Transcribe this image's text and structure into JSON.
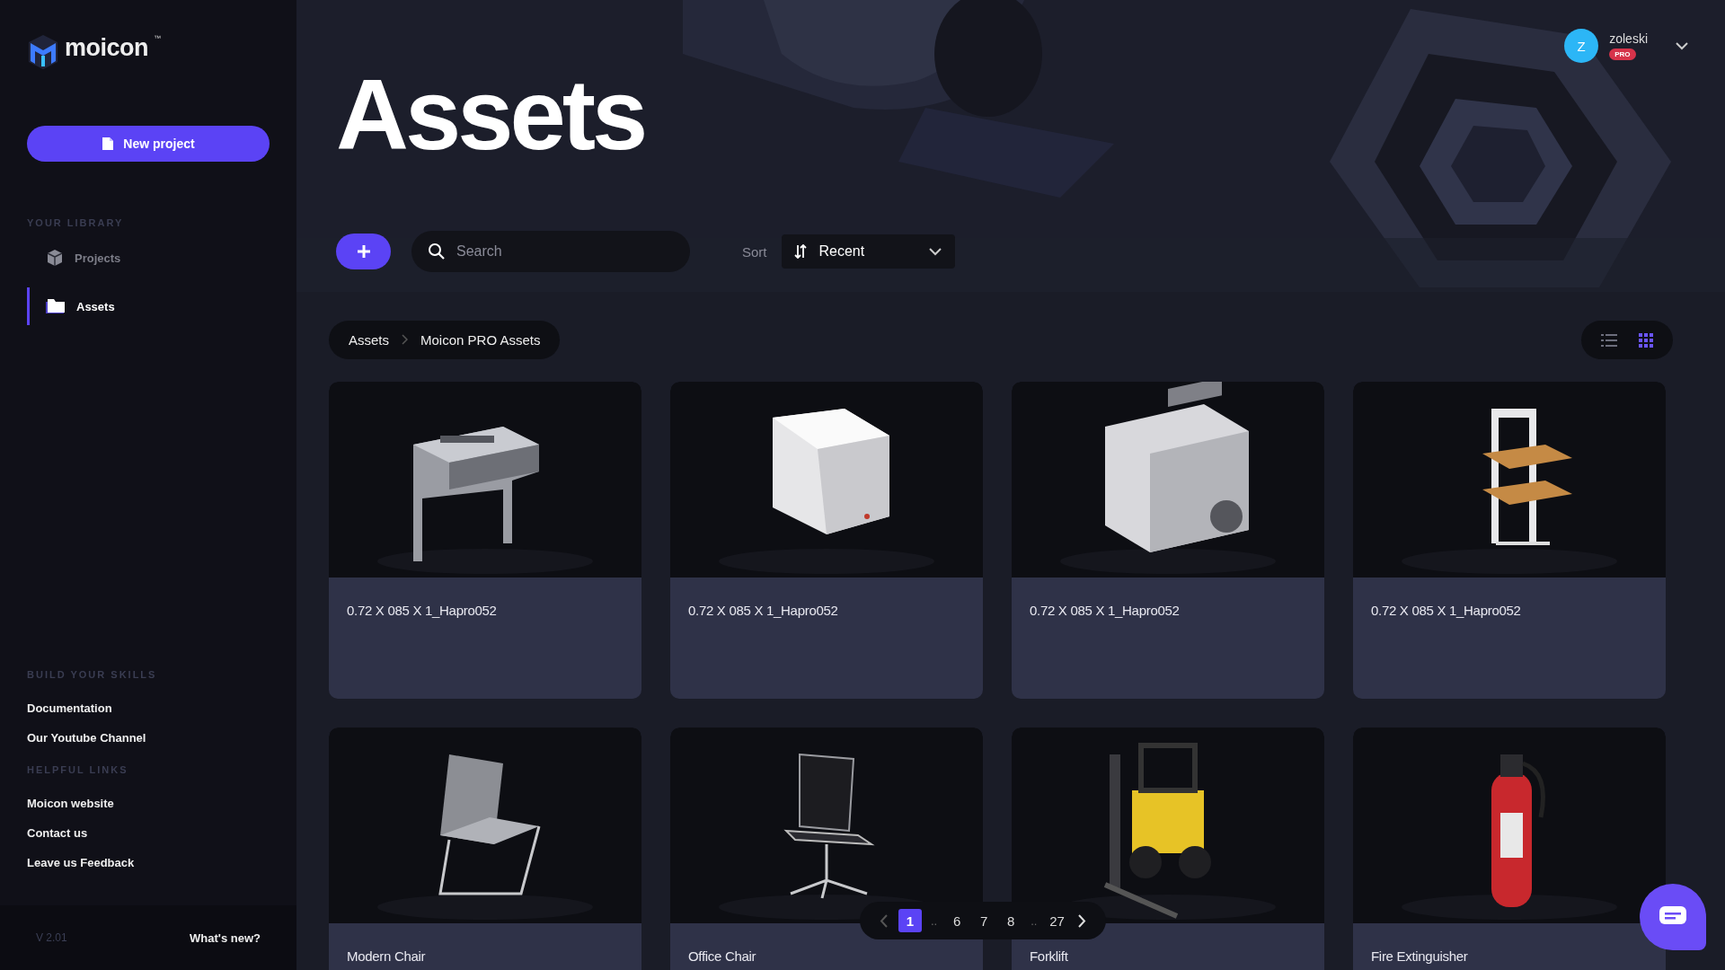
{
  "sidebar": {
    "logo": "moicon",
    "logo_tm": "™",
    "new_project_button": "New project",
    "library": {
      "heading": "YOUR LIBRARY",
      "items": [
        {
          "label": "Projects",
          "selected": false
        },
        {
          "label": "Assets",
          "selected": true
        }
      ]
    },
    "skills": {
      "heading": "BUILD YOUR SKILLS",
      "links": [
        "Documentation",
        "Our Youtube Channel"
      ]
    },
    "helpful": {
      "heading": "HELPFUL LINKS",
      "links": [
        "Moicon website",
        "Contact us",
        "Leave us Feedback"
      ]
    },
    "version": "V 2.01",
    "whats_new": "What's new?"
  },
  "user": {
    "initial": "Z",
    "name": "zoleski",
    "badge": "PRO"
  },
  "page_title": "Assets",
  "toolbar": {
    "search": {
      "placeholder": "Search"
    },
    "sort_label": "Sort",
    "sort_value": "Recent"
  },
  "breadcrumb": [
    "Assets",
    "Moicon PRO Assets"
  ],
  "view_toggle": [
    {
      "kind": "list",
      "selected": false
    },
    {
      "kind": "grid",
      "selected": true
    }
  ],
  "assets": [
    {
      "title": "0.72 X 085 X 1_Hapro052"
    },
    {
      "title": "0.72 X 085 X 1_Hapro052"
    },
    {
      "title": "0.72 X 085 X 1_Hapro052"
    },
    {
      "title": "0.72 X 085 X 1_Hapro052"
    },
    {
      "title": "Modern Chair"
    },
    {
      "title": "Office Chair"
    },
    {
      "title": "Forklift"
    },
    {
      "title": "Fire Extinguisher"
    }
  ],
  "pagination": [
    {
      "kind": "prev"
    },
    {
      "kind": "page",
      "label": "1",
      "selected": true
    },
    {
      "kind": "gap",
      "label": ".."
    },
    {
      "kind": "page",
      "label": "6",
      "selected": false
    },
    {
      "kind": "page",
      "label": "7",
      "selected": false
    },
    {
      "kind": "page",
      "label": "8",
      "selected": false
    },
    {
      "kind": "gap",
      "label": ".."
    },
    {
      "kind": "page",
      "label": "27",
      "selected": false
    },
    {
      "kind": "next"
    }
  ]
}
